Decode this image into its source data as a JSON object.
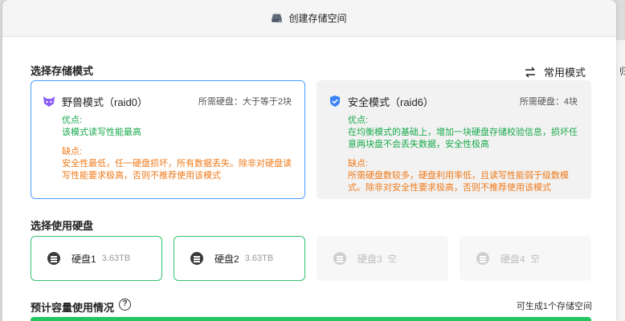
{
  "window": {
    "title": "创建存储空间"
  },
  "background": {
    "edge_text": "归"
  },
  "mode_section": {
    "title": "选择存储模式",
    "switch_label": "常用模式",
    "modes": [
      {
        "name": "野兽模式（raid0）",
        "requirement": "所需硬盘：大于等于2块",
        "pros_label": "优点:",
        "pros_text": "该模式读写性能最高",
        "cons_label": "缺点:",
        "cons_text": "安全性最低，任一硬盘损坏，所有数据丢失。除非对硬盘读写性能要求极高，否则不推荐使用该模式",
        "selected": true
      },
      {
        "name": "安全模式（raid6）",
        "requirement": "所需硬盘：4块",
        "pros_label": "优点:",
        "pros_text": "在均衡模式的基础上，增加一块硬盘存储校验信息，损坏任意两块盘不会丢失数据，安全性极高",
        "cons_label": "缺点:",
        "cons_text": "所需硬盘数较多，硬盘利用率低，且读写性能弱于级数模式。除非对安全性要求极高，否则不推荐使用该模式",
        "selected": false
      }
    ]
  },
  "disk_section": {
    "title": "选择使用硬盘",
    "disks": [
      {
        "name": "硬盘1",
        "meta": "3.63TB",
        "selected": true
      },
      {
        "name": "硬盘2",
        "meta": "3.63TB",
        "selected": true
      },
      {
        "name": "硬盘3",
        "meta": "空",
        "selected": false
      },
      {
        "name": "硬盘4",
        "meta": "空",
        "selected": false
      }
    ]
  },
  "capacity_section": {
    "title": "预计容量使用情况",
    "help_glyph": "?",
    "note": "可生成1个存储空间",
    "bar_color": "#22c55e"
  },
  "colors": {
    "accent_blue": "#4a9eff",
    "green": "#17a94a",
    "orange": "#f07a1a",
    "disk_selected_border": "#33c46a"
  },
  "icons": {
    "window": "drive-icon",
    "switch": "swap-arrows-icon",
    "mode_0": "purple-beast-icon",
    "mode_1": "blue-shield-check-icon",
    "disk": "hard-disk-icon",
    "help": "question-circle-icon"
  }
}
